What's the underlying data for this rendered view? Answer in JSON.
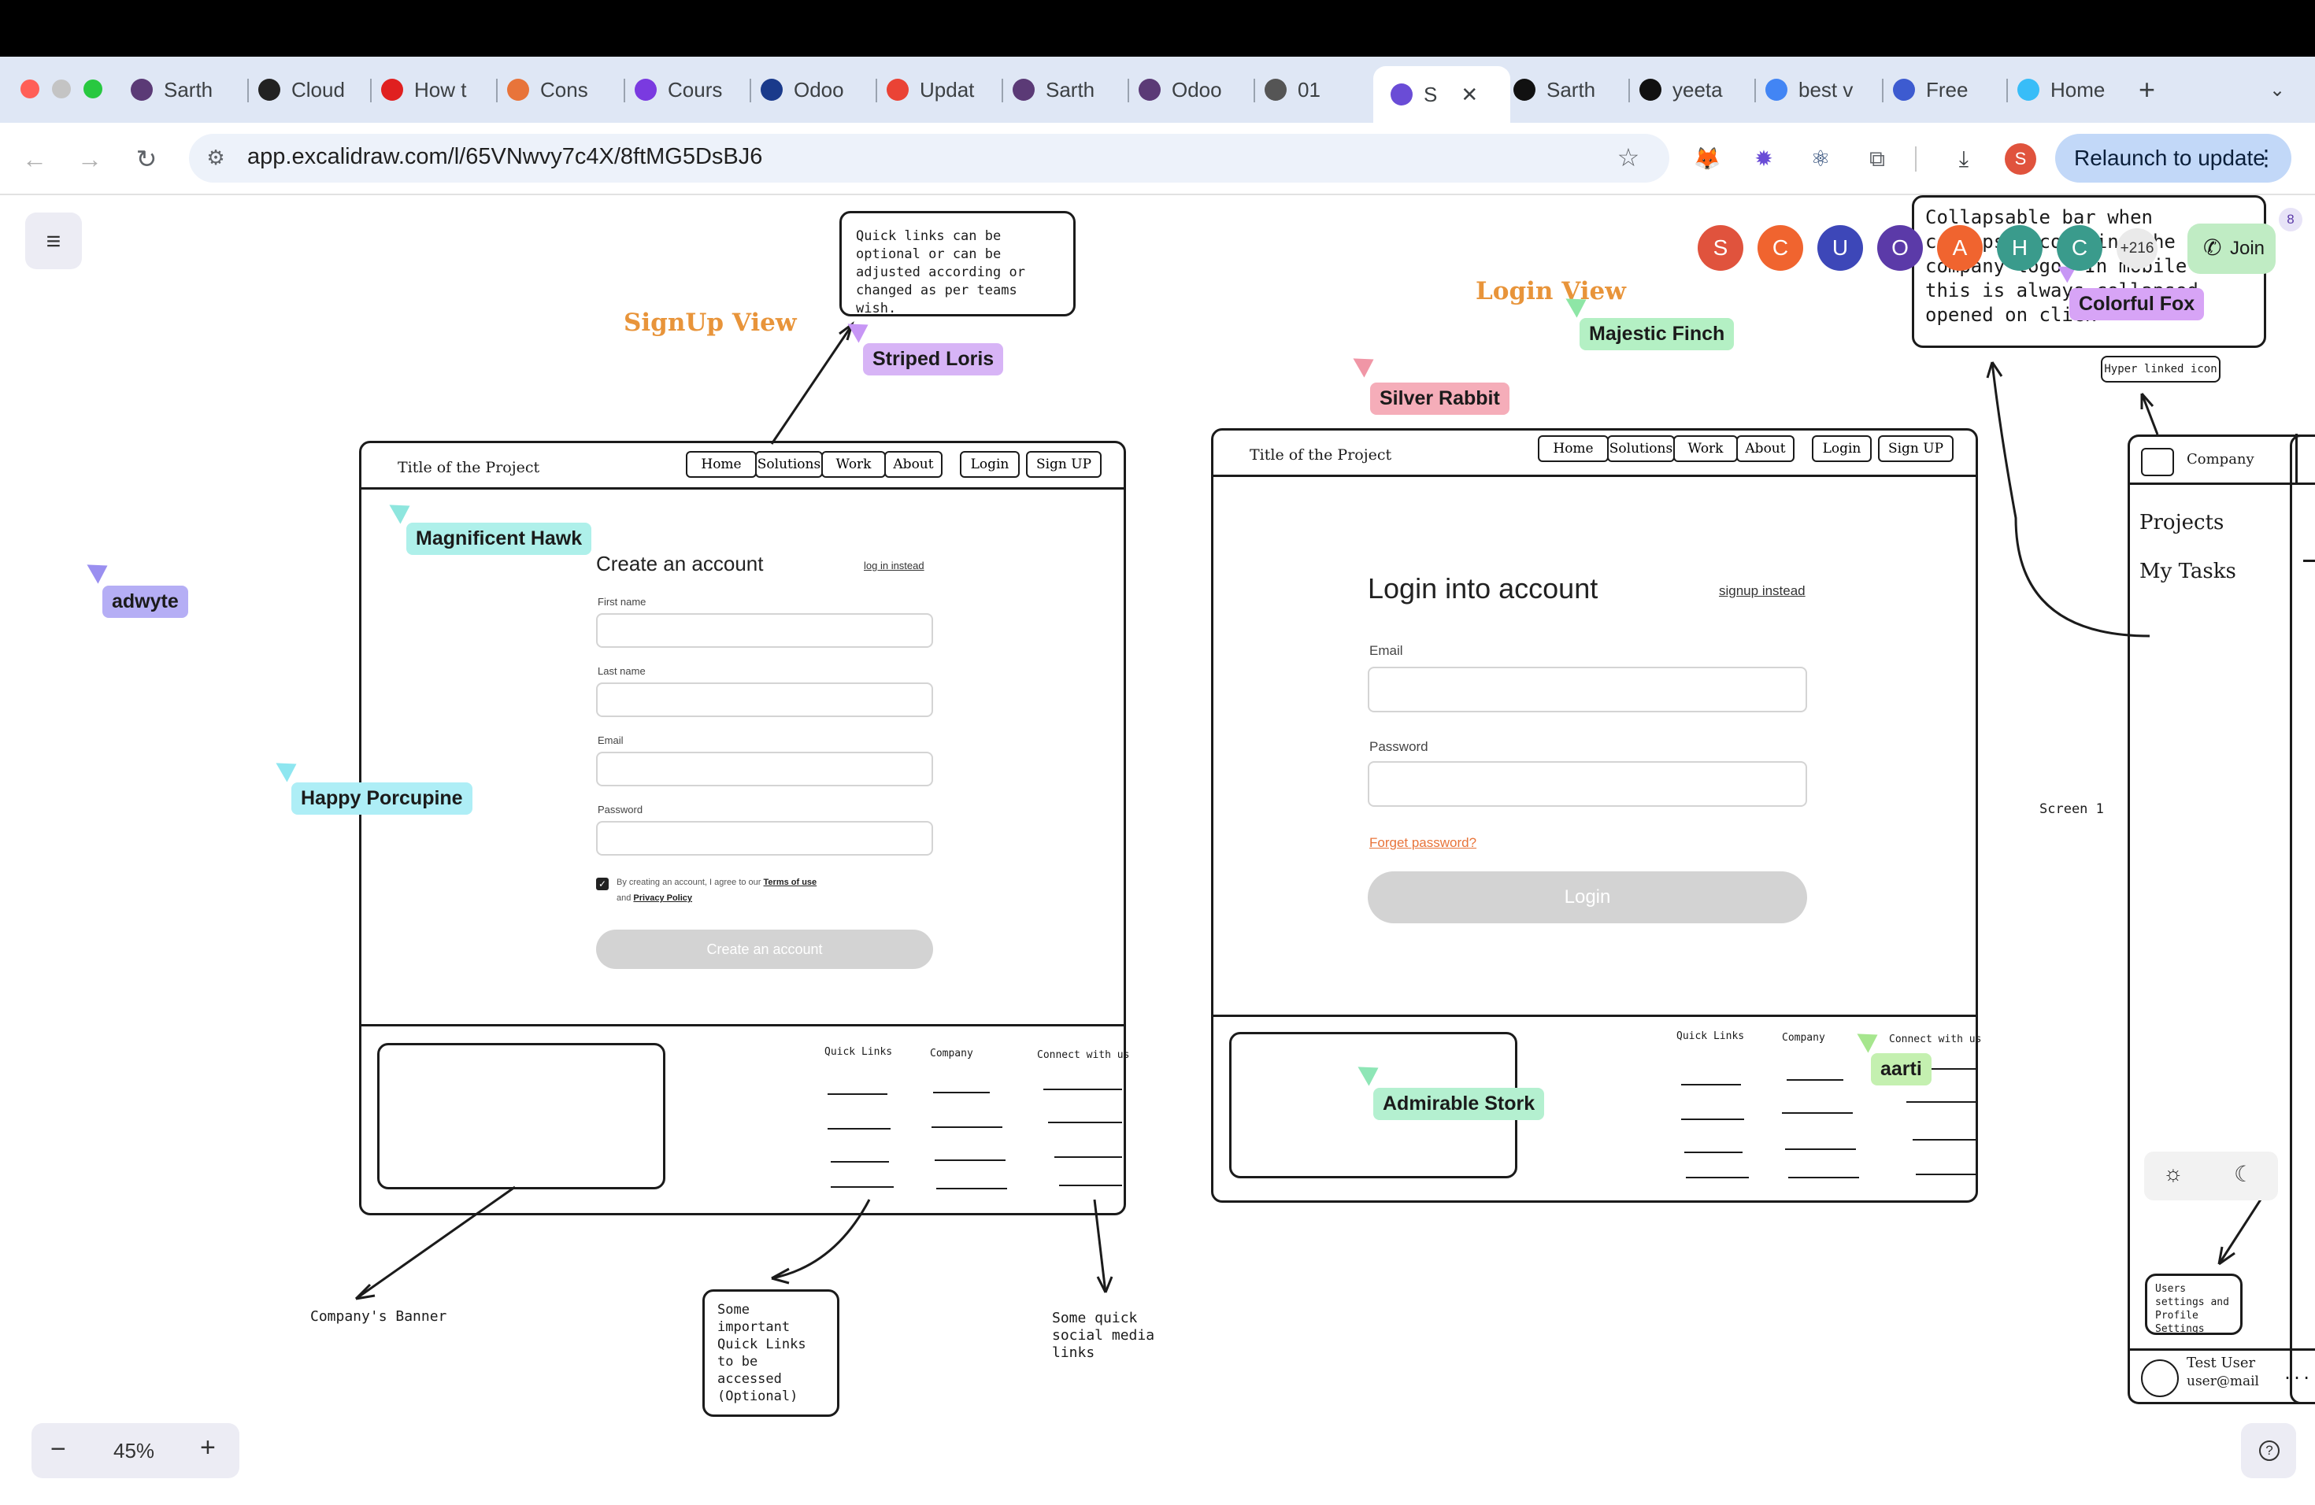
{
  "browser": {
    "tabs": [
      {
        "label": "Sarth",
        "icon": "circle-icon"
      },
      {
        "label": "Cloud",
        "icon": "openai-icon"
      },
      {
        "label": "How t",
        "icon": "youtube-icon"
      },
      {
        "label": "Cons",
        "icon": "box-icon"
      },
      {
        "label": "Cours",
        "icon": "udemy-icon"
      },
      {
        "label": "Odoo",
        "icon": "unstop-icon"
      },
      {
        "label": "Updat",
        "icon": "gmail-icon"
      },
      {
        "label": "Sarth",
        "icon": "circle-icon"
      },
      {
        "label": "Odoo",
        "icon": "circle-icon"
      },
      {
        "label": "01",
        "icon": "globe-icon"
      },
      {
        "label": "S",
        "icon": "excalidraw-icon",
        "active": true
      },
      {
        "label": "Sarth",
        "icon": "github-icon"
      },
      {
        "label": "yeeta",
        "icon": "github-icon"
      },
      {
        "label": "best v",
        "icon": "google-icon"
      },
      {
        "label": "Free",
        "icon": "chart-icon"
      },
      {
        "label": "Home",
        "icon": "tailwind-icon"
      }
    ],
    "new_tab": "+",
    "url": "app.excalidraw.com/l/65VNwvy7c4X/8ftMG5DsBJ6",
    "relaunch_label": "Relaunch to update",
    "profile_initial": "S"
  },
  "excalidraw": {
    "zoom": "45%",
    "zoom_minus": "−",
    "zoom_plus": "+",
    "help": "?",
    "join_label": "Join",
    "collaborator_count": "+216",
    "badge_count": "8",
    "avatars": [
      {
        "initial": "S",
        "color": "#e0533d"
      },
      {
        "initial": "C",
        "color": "#f0642f"
      },
      {
        "initial": "U",
        "color": "#3d47b8"
      },
      {
        "initial": "O",
        "color": "#5b3aa8"
      },
      {
        "initial": "A",
        "color": "#f0642f"
      },
      {
        "initial": "H",
        "color": "#3a9b8c"
      },
      {
        "initial": "C",
        "color": "#3a9b8c"
      }
    ]
  },
  "cursors": {
    "striped_loris": "Striped Loris",
    "magnificent_hawk": "Magnificent Hawk",
    "adwyte": "adwyte",
    "happy_porcupine": "Happy Porcupine",
    "silver_rabbit": "Silver Rabbit",
    "majestic_finch": "Majestic Finch",
    "colorful_fox": "Colorful Fox",
    "admirable_stork": "Admirable Stork",
    "aarti": "aarti"
  },
  "notes": {
    "quick_links_optional": "Quick links can be optional or can be adjusted according or changed as per teams wish.",
    "collapsable": "Collapsable bar when collapsed contains the company logo. In mobile view this is always collapsed opened on click",
    "hyper_linked": "Hyper linked icon",
    "company_banner": "Company's Banner",
    "important_quick_links": "Some important Quick Links to be accessed (Optional)",
    "social_links": "Some quick social media links",
    "screen1": "Screen 1",
    "user_settings": "Users settings and Profile Settings"
  },
  "signup": {
    "view_title": "SignUp View",
    "project_title": "Title of the Project",
    "nav": [
      "Home",
      "Solutions",
      "Work",
      "About",
      "Login",
      "Sign UP"
    ],
    "heading": "Create an account",
    "login_link": "log in instead",
    "labels": [
      "First name",
      "Last name",
      "Email",
      "Password"
    ],
    "terms_prefix": "By creating an account, I agree to our",
    "terms_link": "Terms of use",
    "and": "and",
    "privacy_link": "Privacy Policy",
    "submit": "Create an account",
    "footer_cols": [
      "Quick Links",
      "Company",
      "Connect with us"
    ]
  },
  "login": {
    "view_title": "Login View",
    "project_title": "Title of the Project",
    "nav": [
      "Home",
      "Solutions",
      "Work",
      "About",
      "Login",
      "Sign UP"
    ],
    "heading": "Login into  account",
    "signup_link": "signup instead",
    "email_label": "Email",
    "password_label": "Password",
    "forgot": "Forget password?",
    "submit": "Login",
    "footer_cols": [
      "Quick Links",
      "Company",
      "Connect with us"
    ]
  },
  "dashboard": {
    "company": "Company",
    "projects": "Projects",
    "my_tasks": "My Tasks",
    "user_name": "Test User",
    "user_mail": "user@mail",
    "more": "..."
  }
}
